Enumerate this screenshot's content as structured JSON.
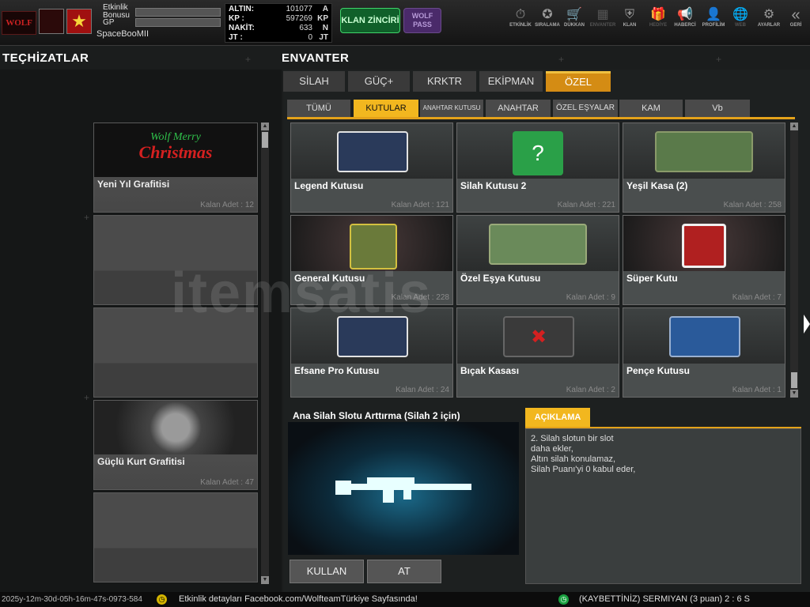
{
  "player": {
    "logo_text": "WOLF",
    "logo_sub": "DIRILIS",
    "event_bonus_label": "Etkinlik Bonusu",
    "gp_label": "GP",
    "name": "SpaceBooMII"
  },
  "currency": [
    {
      "label": "ALTIN:",
      "value": "101077",
      "unit": "A"
    },
    {
      "label": "KP :",
      "value": "597269",
      "unit": "KP"
    },
    {
      "label": "NAKİT:",
      "value": "633",
      "unit": "N"
    },
    {
      "label": "JT :",
      "value": "0",
      "unit": "JT"
    }
  ],
  "buttons": {
    "klan_zinciri": "KLAN ZİNCİRİ",
    "wolf_pass": "WOLF PASS"
  },
  "menu": [
    {
      "label": "ETKİNLİK",
      "icon": "stopwatch-icon",
      "glyph": "⏱"
    },
    {
      "label": "SIRALAMA",
      "icon": "medal-icon",
      "glyph": "✪"
    },
    {
      "label": "DÜKKAN",
      "icon": "cart-icon",
      "glyph": "🛒"
    },
    {
      "label": "ENVANTER",
      "icon": "inventory-icon",
      "glyph": "▦"
    },
    {
      "label": "KLAN",
      "icon": "shield-icon",
      "glyph": "⛨"
    },
    {
      "label": "HEDİYE",
      "icon": "gift-icon",
      "glyph": "🎁"
    },
    {
      "label": "HABERCİ",
      "icon": "megaphone-icon",
      "glyph": "📢"
    },
    {
      "label": "PROFİLİM",
      "icon": "profile-icon",
      "glyph": "👤"
    },
    {
      "label": "WEB",
      "icon": "globe-icon",
      "glyph": "🌐"
    },
    {
      "label": "AYARLAR",
      "icon": "gear-icon",
      "glyph": "⚙"
    },
    {
      "label": "GERİ",
      "icon": "back-icon",
      "glyph": "«"
    }
  ],
  "left": {
    "title": "TEÇHİZATLAR",
    "xmas_line1": "Wolf Merry",
    "xmas_line2": "Christmas",
    "items": [
      {
        "name": "Yeni Yıl Grafitisi",
        "qty": "Kalan Adet : 12"
      },
      {
        "name": "",
        "qty": ""
      },
      {
        "name": "",
        "qty": ""
      },
      {
        "name": "Güçlü Kurt Grafitisi",
        "qty": "Kalan Adet : 47"
      },
      {
        "name": "",
        "qty": ""
      }
    ]
  },
  "inventory": {
    "title": "ENVANTER",
    "tabs": [
      "SİLAH",
      "GÜÇ+",
      "KRKTR",
      "EKİPMAN",
      "ÖZEL"
    ],
    "subtabs": [
      "TÜMÜ",
      "KUTULAR",
      "ANAHTAR KUTUSU",
      "ANAHTAR",
      "ÖZEL EŞYALAR",
      "KAM",
      "Vb"
    ],
    "items": [
      {
        "name": "Legend Kutusu",
        "qty": "Kalan Adet : 121",
        "color": "#2a3a5a"
      },
      {
        "name": "Silah Kutusu 2",
        "qty": "Kalan Adet : 221",
        "color": "#2aa048"
      },
      {
        "name": "Yeşil Kasa (2)",
        "qty": "Kalan Adet : 258",
        "color": "#5a7a4a"
      },
      {
        "name": "General Kutusu",
        "qty": "Kalan Adet : 228",
        "color": "#6a7a3a"
      },
      {
        "name": "Özel Eşya Kutusu",
        "qty": "Kalan Adet : 9",
        "color": "#6a8a5a"
      },
      {
        "name": "Süper Kutu",
        "qty": "Kalan Adet : 7",
        "color": "#b02020"
      },
      {
        "name": "Efsane Pro Kutusu",
        "qty": "Kalan Adet : 24",
        "color": "#2a3a5a"
      },
      {
        "name": "Bıçak Kasası",
        "qty": "Kalan Adet : 2",
        "color": "#3a3a3a"
      },
      {
        "name": "Pençe Kutusu",
        "qty": "Kalan Adet : 1",
        "color": "#2a5a9a"
      }
    ]
  },
  "detail": {
    "title": "Ana Silah Slotu Arttırma (Silah 2 için)",
    "desc_tab": "AÇIKLAMA",
    "desc_lines": [
      "2. Silah slotun bir slot",
      "daha ekler,",
      "Altın silah konulamaz,",
      "Silah Puanı'yi 0 kabul eder,"
    ],
    "use_btn": "KULLAN",
    "drop_btn": "AT"
  },
  "status": {
    "timestamp": "2025y-12m-30d-05h-16m-47s-0973-584",
    "ticker": "Etkinlik detayları Facebook.com/WolfteamTürkiye Sayfasında!",
    "score": "(KAYBETTİNİZ) SERMIYAN (3 puan) 2 : 6 S"
  },
  "watermark": "itemsatis"
}
